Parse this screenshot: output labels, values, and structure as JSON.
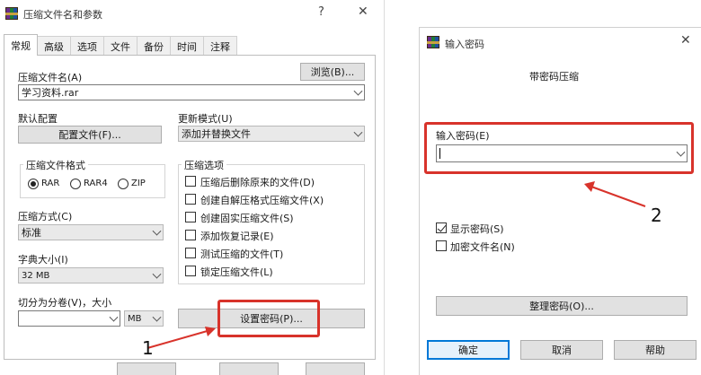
{
  "compress_dialog": {
    "title": "压缩文件名和参数",
    "help_glyph": "?",
    "close_glyph": "✕",
    "tabs": [
      "常规",
      "高级",
      "选项",
      "文件",
      "备份",
      "时间",
      "注释"
    ],
    "archive_name_label": "压缩文件名(A)",
    "archive_name_value": "学习资料.rar",
    "browse_button": "浏览(B)...",
    "default_profile_label": "默认配置",
    "profiles_button": "配置文件(F)...",
    "update_mode_label": "更新模式(U)",
    "update_mode_value": "添加并替换文件",
    "format_group_title": "压缩文件格式",
    "formats": [
      "RAR",
      "RAR4",
      "ZIP"
    ],
    "selected_format_index": 0,
    "options_group_title": "压缩选项",
    "options": [
      {
        "label": "压缩后删除原来的文件(D)",
        "checked": false
      },
      {
        "label": "创建自解压格式压缩文件(X)",
        "checked": false
      },
      {
        "label": "创建固实压缩文件(S)",
        "checked": false
      },
      {
        "label": "添加恢复记录(E)",
        "checked": false
      },
      {
        "label": "测试压缩的文件(T)",
        "checked": false
      },
      {
        "label": "锁定压缩文件(L)",
        "checked": false
      }
    ],
    "method_label": "压缩方式(C)",
    "method_value": "标准",
    "dict_label": "字典大小(I)",
    "dict_value": "32 MB",
    "split_label": "切分为分卷(V)，大小",
    "split_value": "",
    "split_unit": "MB",
    "set_password_button": "设置密码(P)..."
  },
  "password_dialog": {
    "title": "输入密码",
    "close_glyph": "✕",
    "subtitle": "带密码压缩",
    "password_label": "输入密码(E)",
    "password_value": "",
    "show_password": {
      "label": "显示密码(S)",
      "checked": true
    },
    "encrypt_names": {
      "label": "加密文件名(N)",
      "checked": false
    },
    "organize_button": "整理密码(O)...",
    "ok_button": "确定",
    "cancel_button": "取消",
    "help_button": "帮助"
  },
  "annotations": {
    "marker_1": "1",
    "marker_2": "2",
    "highlight_color": "#d8332b"
  }
}
